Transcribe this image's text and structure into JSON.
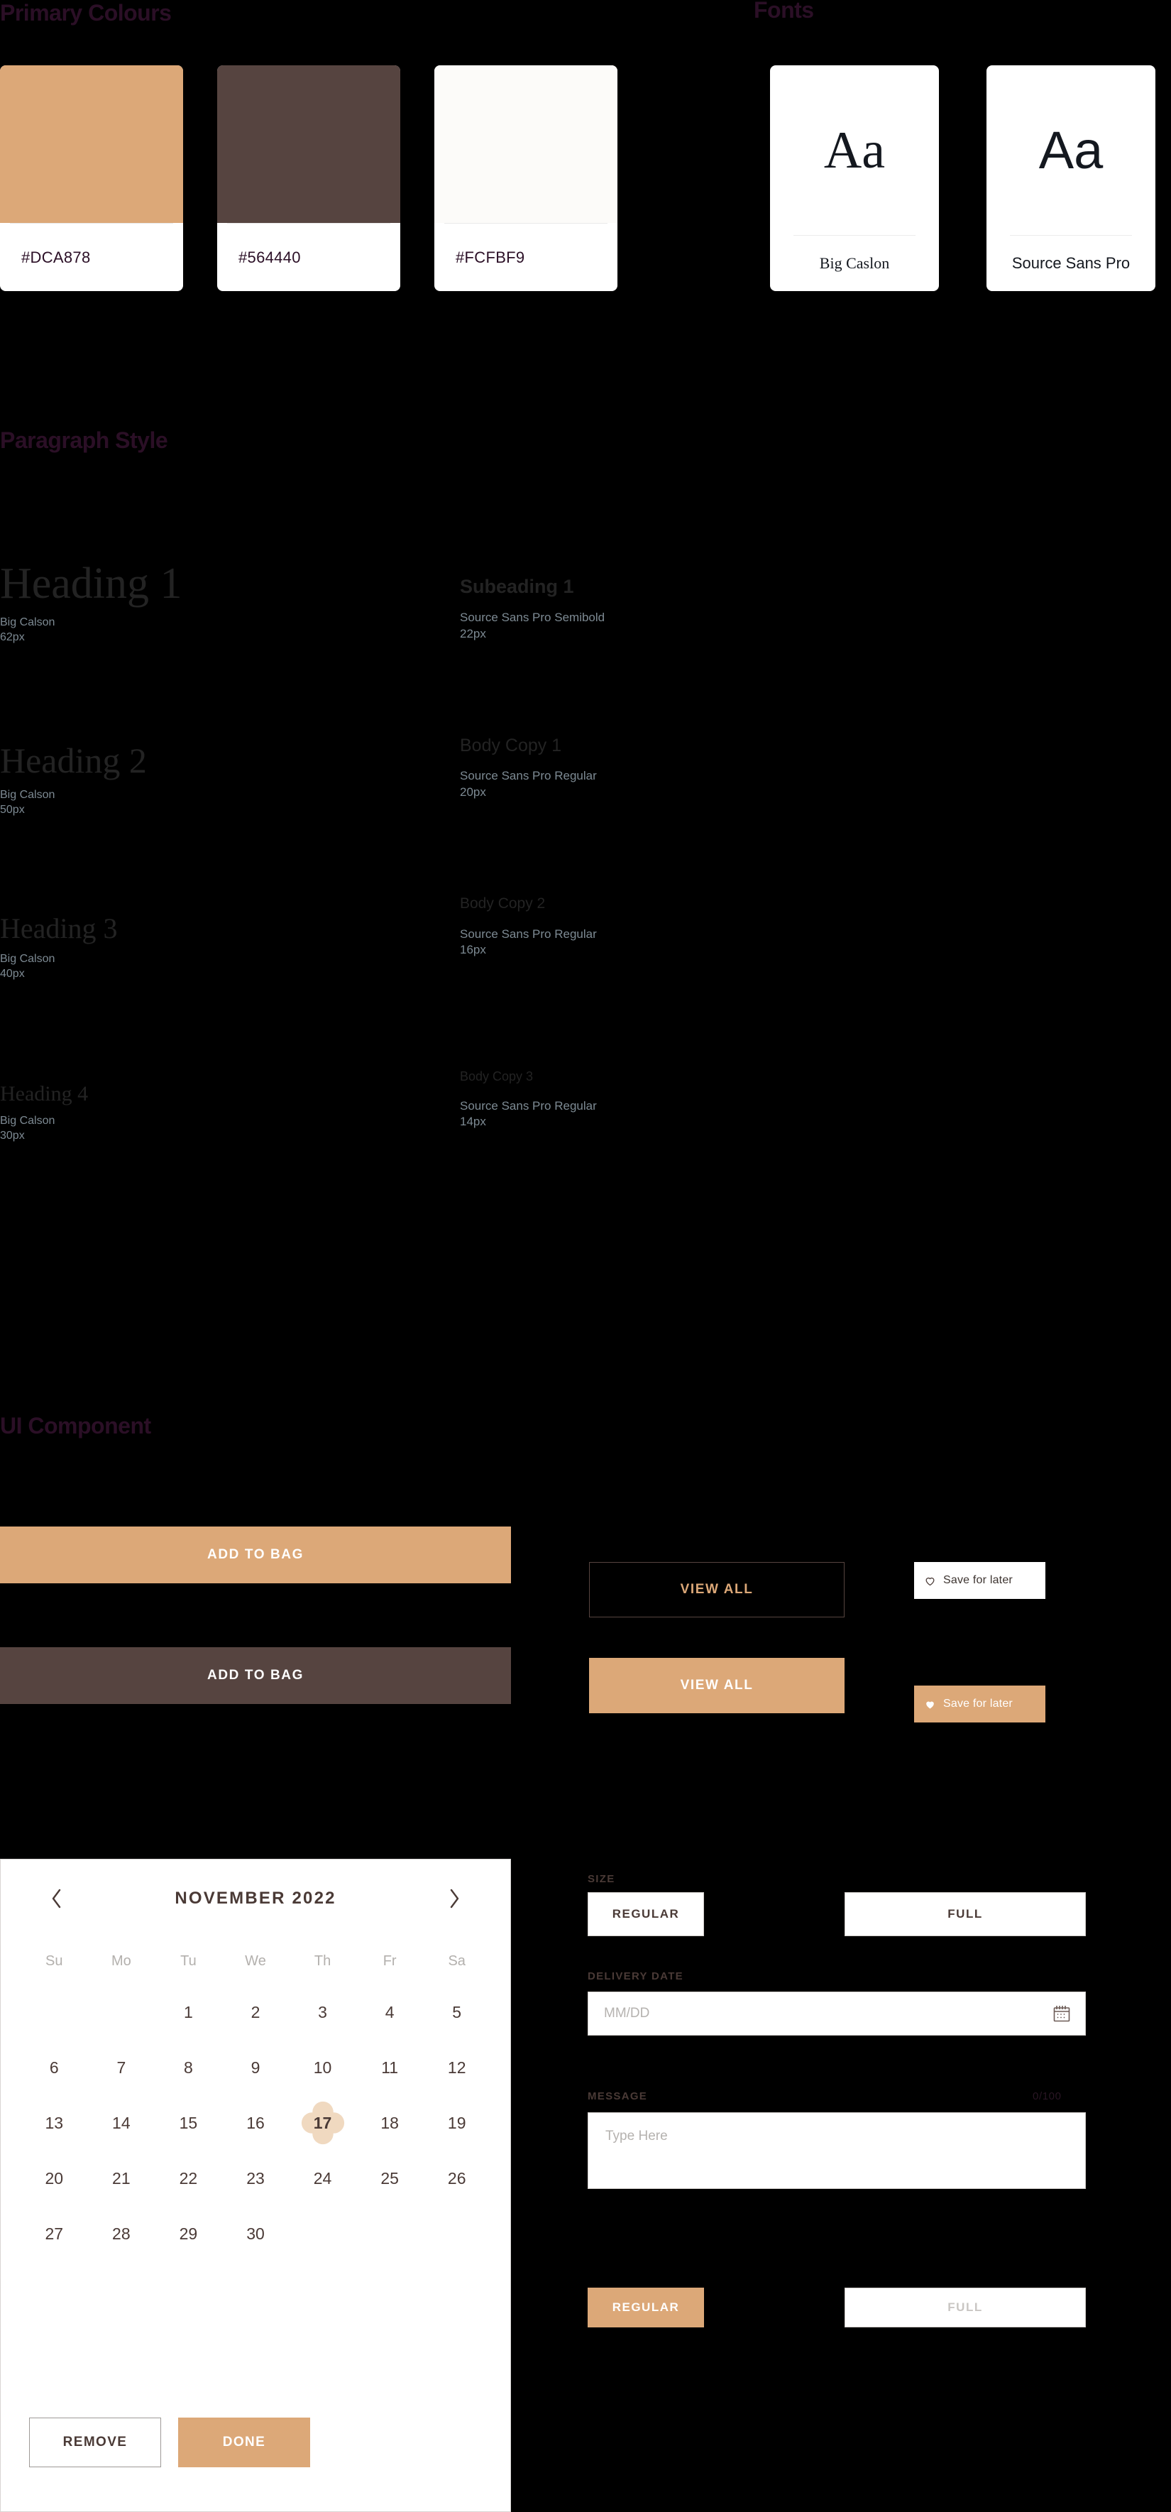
{
  "sections": {
    "primary_colours": "Primary Colours",
    "fonts": "Fonts",
    "paragraph_style": "Paragraph Style",
    "ui_component": "UI Component"
  },
  "colors": {
    "tan": "#DCA878",
    "brown": "#564440",
    "offwhite": "#FCFBF9",
    "heading_accent": "#2b0f26",
    "swatches": [
      {
        "hex": "#DCA878",
        "label": "#DCA878"
      },
      {
        "hex": "#564440",
        "label": "#564440"
      },
      {
        "hex": "#FCFBF9",
        "label": "#FCFBF9"
      }
    ]
  },
  "fonts": [
    {
      "sample": "Aa",
      "name": "Big Caslon",
      "style": "serif"
    },
    {
      "sample": "Aa",
      "name": "Source Sans Pro",
      "style": "sans"
    }
  ],
  "type_scale": {
    "left": [
      {
        "sample": "Heading 1",
        "family": "Big Calson",
        "size": "62px"
      },
      {
        "sample": "Heading 2",
        "family": "Big Calson",
        "size": "50px"
      },
      {
        "sample": "Heading 3",
        "family": "Big Calson",
        "size": "40px"
      },
      {
        "sample": "Heading 4",
        "family": "Big Calson",
        "size": "30px"
      }
    ],
    "right": [
      {
        "sample": "Subeading 1",
        "family": "Source Sans Pro Semibold",
        "size": "22px"
      },
      {
        "sample": "Body Copy 1",
        "family": "Source Sans Pro Regular",
        "size": "20px"
      },
      {
        "sample": "Body Copy 2",
        "family": "Source Sans Pro Regular",
        "size": "16px"
      },
      {
        "sample": "Body Copy 3",
        "family": "Source Sans Pro Regular",
        "size": "14px"
      }
    ]
  },
  "buttons": {
    "add_to_bag_primary": "ADD TO BAG",
    "add_to_bag_dark": "ADD TO BAG",
    "view_all_ghost": "VIEW ALL",
    "view_all_solid": "VIEW ALL",
    "save_for_later_light": "Save for later",
    "save_for_later_tan": "Save for later"
  },
  "calendar": {
    "month": "NOVEMBER",
    "year": "2022",
    "title": "NOVEMBER  2022",
    "prev_icon": "chevron-left-icon",
    "next_icon": "chevron-right-icon",
    "day_headers": [
      "Su",
      "Mo",
      "Tu",
      "We",
      "Th",
      "Fr",
      "Sa"
    ],
    "leading_blanks": 2,
    "days": [
      1,
      2,
      3,
      4,
      5,
      6,
      7,
      8,
      9,
      10,
      11,
      12,
      13,
      14,
      15,
      16,
      17,
      18,
      19,
      20,
      21,
      22,
      23,
      24,
      25,
      26,
      27,
      28,
      29,
      30
    ],
    "selected_day": 17,
    "remove_label": "REMOVE",
    "done_label": "DONE"
  },
  "form": {
    "size_label": "SIZE",
    "size_options": [
      "REGULAR",
      "FULL"
    ],
    "delivery_label": "DELIVERY DATE",
    "delivery_placeholder": "MM/DD",
    "delivery_icon": "calendar-icon",
    "message_label": "MESSAGE",
    "message_counter": "0/100",
    "message_placeholder": "Type Here",
    "size_state_options": [
      "REGULAR",
      "FULL"
    ],
    "size_state_active": "REGULAR",
    "size_state_disabled": "FULL"
  }
}
